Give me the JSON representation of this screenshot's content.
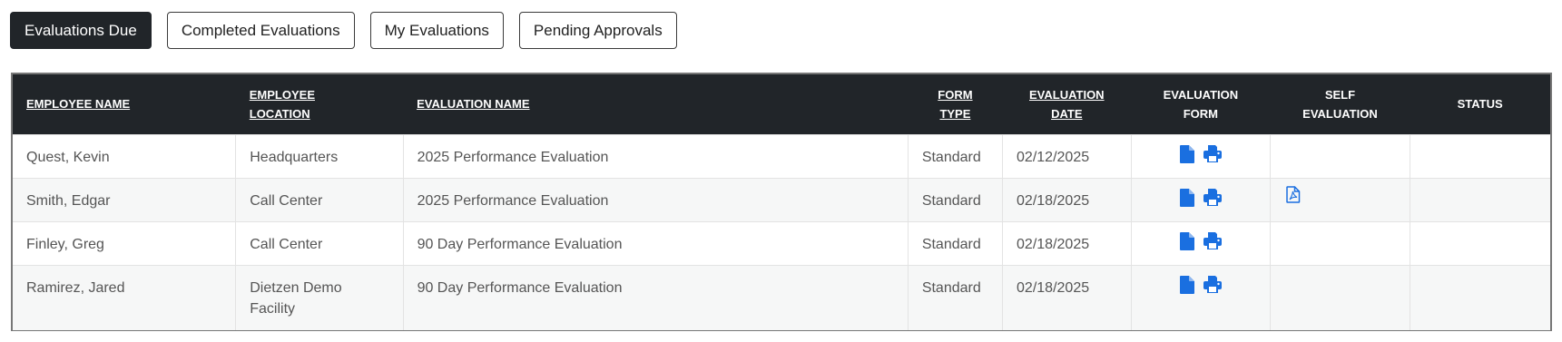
{
  "tabs": [
    {
      "label": "Evaluations Due",
      "active": true
    },
    {
      "label": "Completed Evaluations",
      "active": false
    },
    {
      "label": "My Evaluations",
      "active": false
    },
    {
      "label": "Pending Approvals",
      "active": false
    }
  ],
  "table": {
    "headers": {
      "employee_name": "EMPLOYEE NAME",
      "employee_location_1": "EMPLOYEE",
      "employee_location_2": "LOCATION",
      "evaluation_name": "EVALUATION NAME",
      "form_type_1": "FORM",
      "form_type_2": "TYPE",
      "evaluation_date_1": "EVALUATION",
      "evaluation_date_2": "DATE",
      "evaluation_form_1": "EVALUATION",
      "evaluation_form_2": "FORM",
      "self_evaluation_1": "SELF",
      "self_evaluation_2": "EVALUATION",
      "status": "STATUS"
    },
    "rows": [
      {
        "name": "Quest, Kevin",
        "location": "Headquarters",
        "evaluation": "2025 Performance Evaluation",
        "form_type": "Standard",
        "date": "02/12/2025",
        "self_evaluation_icon": "",
        "status": ""
      },
      {
        "name": "Smith, Edgar",
        "location": "Call Center",
        "evaluation": "2025 Performance Evaluation",
        "form_type": "Standard",
        "date": "02/18/2025",
        "self_evaluation_icon": "pdf-file-icon",
        "status": ""
      },
      {
        "name": "Finley, Greg",
        "location": "Call Center",
        "evaluation": "90 Day Performance Evaluation",
        "form_type": "Standard",
        "date": "02/18/2025",
        "self_evaluation_icon": "",
        "status": ""
      },
      {
        "name": "Ramirez, Jared",
        "location": "Dietzen Demo Facility",
        "evaluation": "90 Day Performance Evaluation",
        "form_type": "Standard",
        "date": "02/18/2025",
        "self_evaluation_icon": "",
        "status": ""
      }
    ],
    "evaluation_form_icons": [
      "document-icon",
      "print-icon"
    ]
  },
  "colors": {
    "header_bg": "#212529",
    "icon_blue": "#1a6fe0",
    "row_alt_bg": "#f6f7f7",
    "text": "#555555"
  }
}
